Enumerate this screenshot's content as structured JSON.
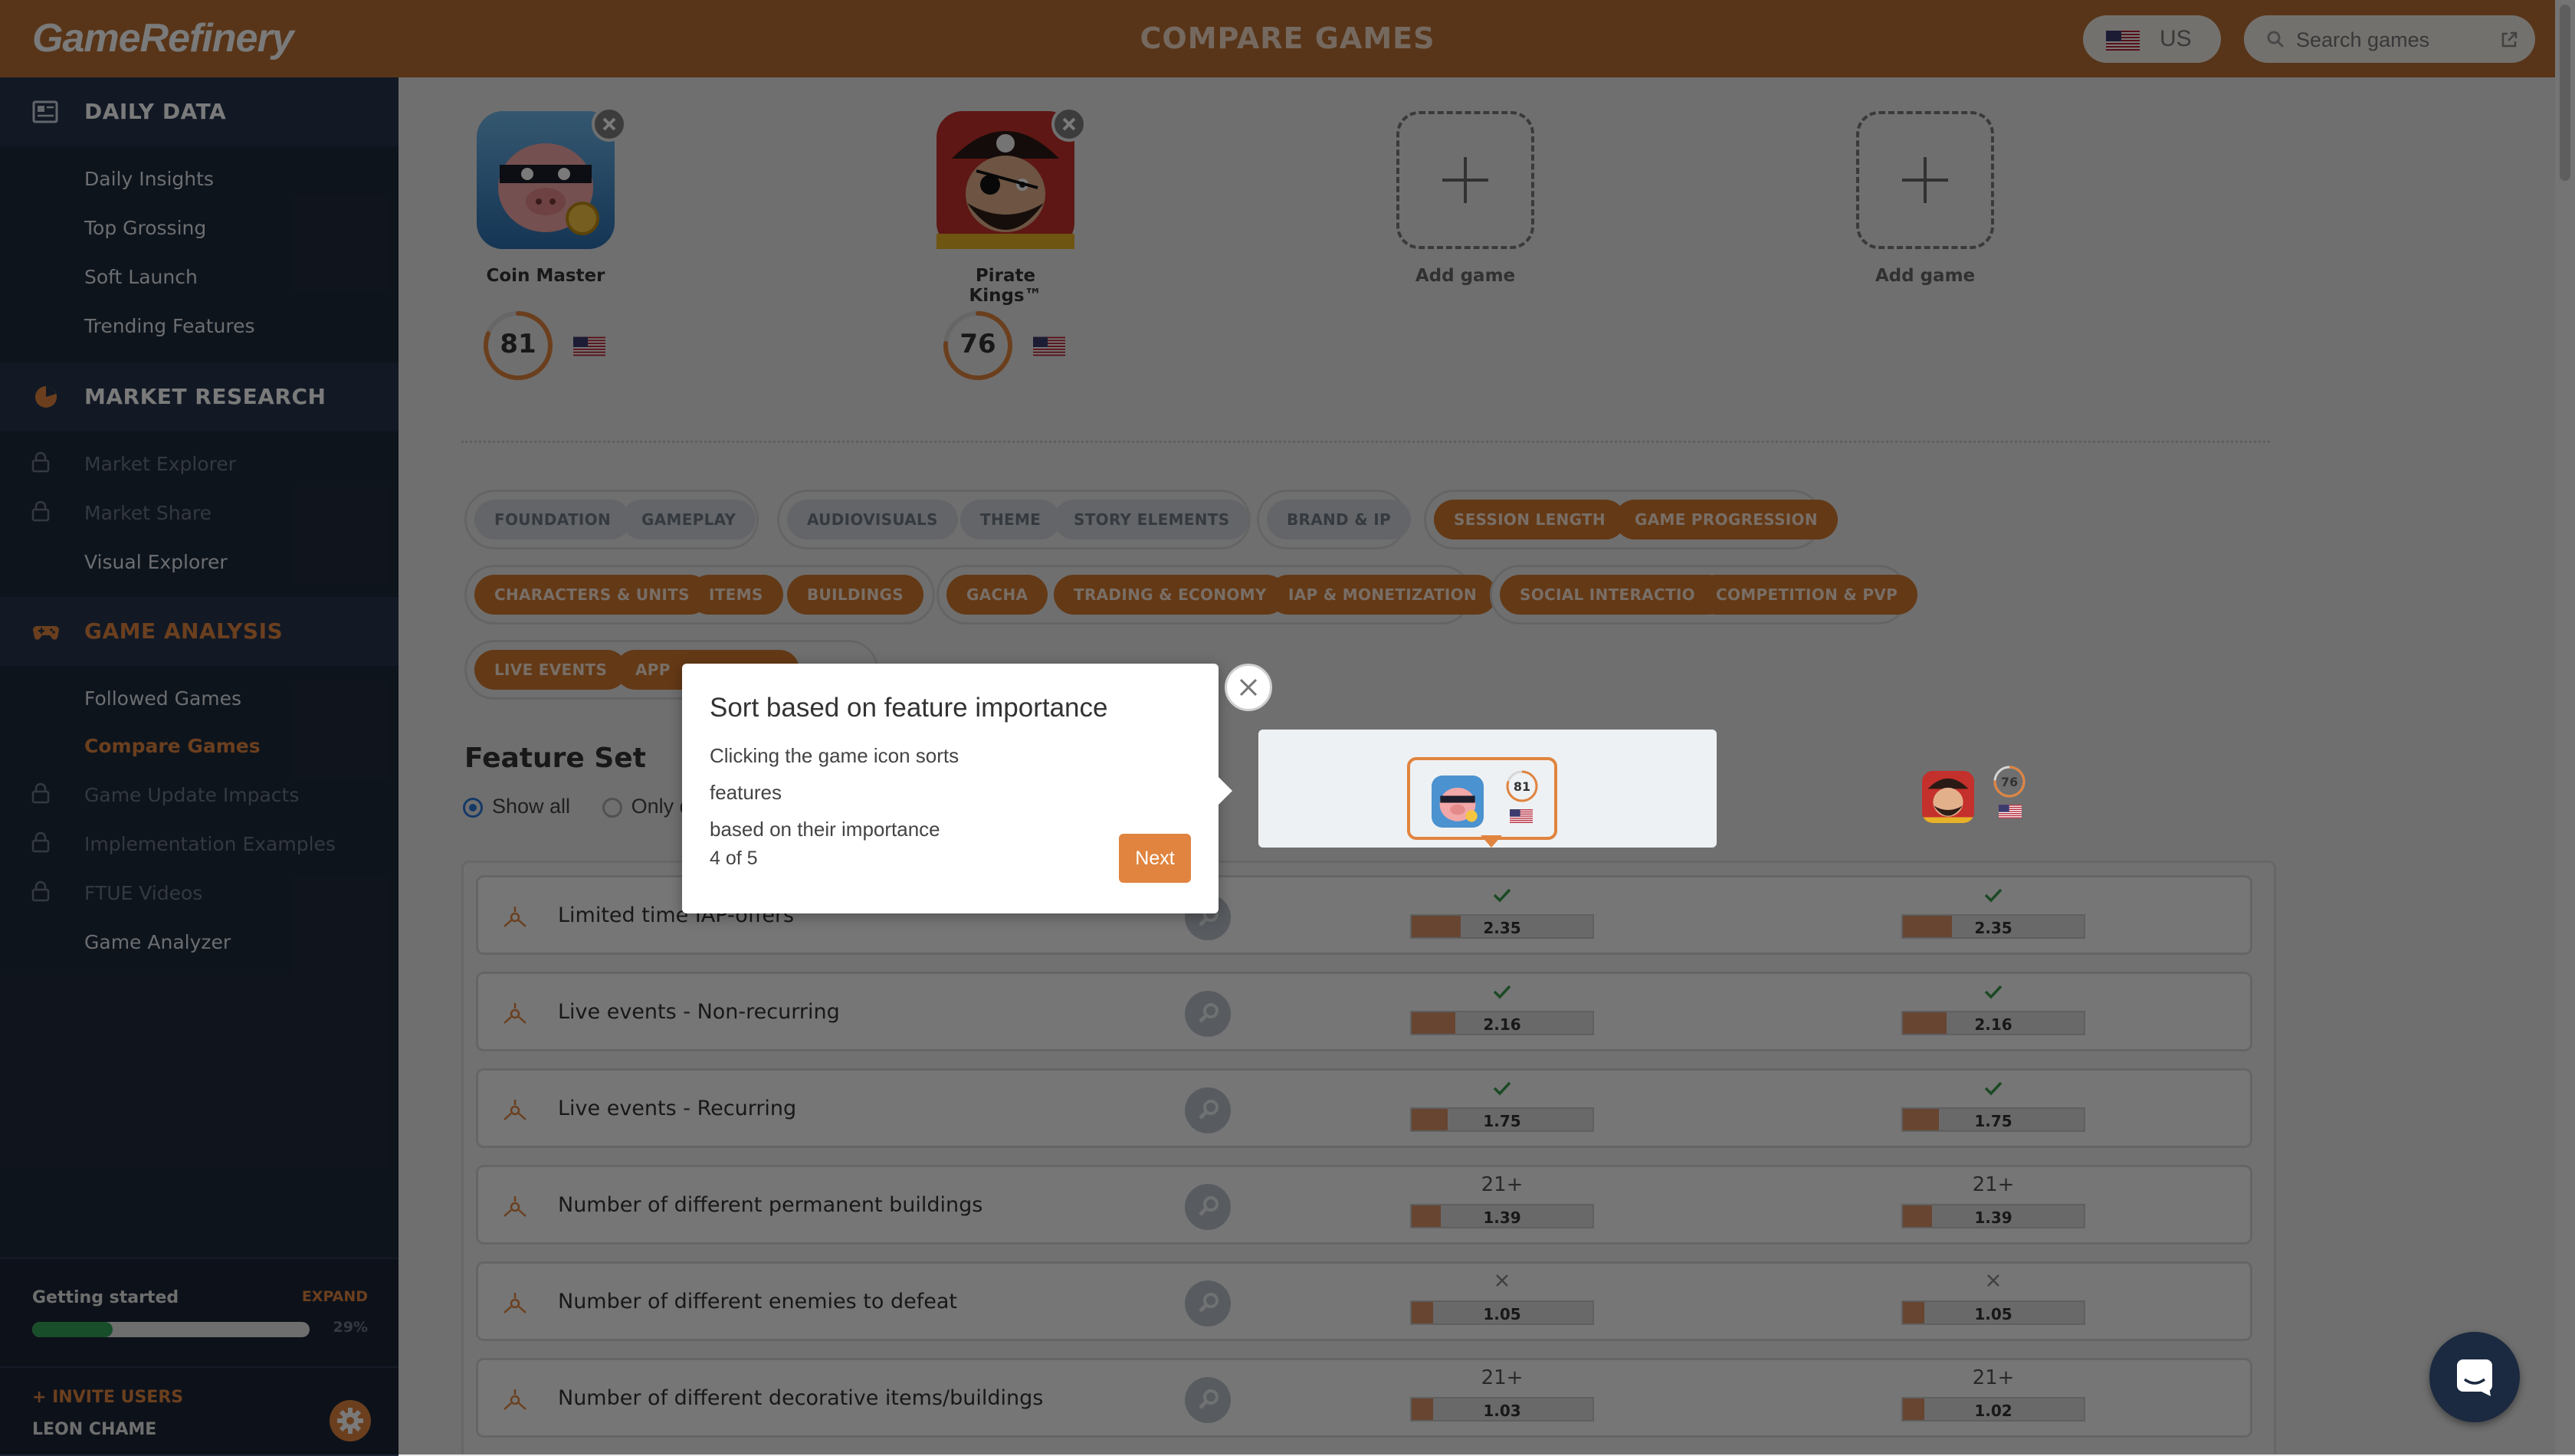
{
  "app": {
    "logo": "GameRefinery",
    "page_title": "COMPARE GAMES"
  },
  "header": {
    "country": "US",
    "search_placeholder": "Search games"
  },
  "sidebar": {
    "sections": [
      {
        "label": "DAILY DATA",
        "icon": "newspaper-icon",
        "items": [
          {
            "label": "Daily Insights",
            "locked": false
          },
          {
            "label": "Top Grossing",
            "locked": false
          },
          {
            "label": "Soft Launch",
            "locked": false
          },
          {
            "label": "Trending Features",
            "locked": false
          }
        ]
      },
      {
        "label": "MARKET RESEARCH",
        "icon": "pie-chart-icon",
        "items": [
          {
            "label": "Market Explorer",
            "locked": true
          },
          {
            "label": "Market Share",
            "locked": true
          },
          {
            "label": "Visual Explorer",
            "locked": false
          }
        ]
      },
      {
        "label": "GAME ANALYSIS",
        "icon": "gamepad-icon",
        "items": [
          {
            "label": "Followed Games",
            "locked": false
          },
          {
            "label": "Compare Games",
            "locked": false,
            "current": true
          },
          {
            "label": "Game Update Impacts",
            "locked": true
          },
          {
            "label": "Implementation Examples",
            "locked": true
          },
          {
            "label": "FTUE Videos",
            "locked": true
          },
          {
            "label": "Game Analyzer",
            "locked": false
          }
        ]
      }
    ],
    "getting_started": {
      "title": "Getting started",
      "expand": "EXPAND",
      "progress_pct": 29,
      "progress_text": "29%"
    },
    "invite": "+ INVITE USERS",
    "user_name": "LEON CHAME"
  },
  "games": [
    {
      "name": "Coin Master",
      "score": 81,
      "flag": "US"
    },
    {
      "name": "Pirate Kings™",
      "score": 76,
      "flag": "US"
    }
  ],
  "add_game_label": "Add game",
  "filter_groups": [
    [
      "FOUNDATION",
      "GAMEPLAY"
    ],
    [
      "AUDIOVISUALS",
      "THEME",
      "STORY ELEMENTS"
    ],
    [
      "BRAND & IP"
    ],
    [
      "SESSION LENGTH",
      "GAME PROGRESSION"
    ],
    [
      "CHARACTERS & UNITS",
      "ITEMS",
      "BUILDINGS"
    ],
    [
      "GACHA",
      "TRADING & ECONOMY",
      "IAP & MONETIZATION"
    ],
    [
      "SOCIAL INTERACTION",
      "COMPETITION & PVP"
    ],
    [
      "LIVE EVENTS",
      "APP"
    ]
  ],
  "feature_set": {
    "title": "Feature Set",
    "show_all": "Show all",
    "only_label": "Only d"
  },
  "features": [
    {
      "label": "Limited time IAP-offers",
      "icon": "shop-icon",
      "cells": [
        {
          "mark": "check",
          "value": "2.35",
          "fill": 0.27
        },
        {
          "mark": "check",
          "value": "2.35",
          "fill": 0.27
        }
      ]
    },
    {
      "label": "Live events - Non-recurring",
      "icon": "event-icon",
      "cells": [
        {
          "mark": "check",
          "value": "2.16",
          "fill": 0.24
        },
        {
          "mark": "check",
          "value": "2.16",
          "fill": 0.24
        }
      ]
    },
    {
      "label": "Live events - Recurring",
      "icon": "event-icon",
      "cells": [
        {
          "mark": "check",
          "value": "1.75",
          "fill": 0.2
        },
        {
          "mark": "check",
          "value": "1.75",
          "fill": 0.2
        }
      ]
    },
    {
      "label": "Number of different permanent buildings",
      "icon": "progression-icon",
      "cells": [
        {
          "mark": "21+",
          "value": "1.39",
          "fill": 0.16
        },
        {
          "mark": "21+",
          "value": "1.39",
          "fill": 0.16
        }
      ]
    },
    {
      "label": "Number of different enemies to defeat",
      "icon": "progression-icon",
      "cells": [
        {
          "mark": "cross",
          "value": "1.05",
          "fill": 0.12
        },
        {
          "mark": "cross",
          "value": "1.05",
          "fill": 0.12
        }
      ]
    },
    {
      "label": "Number of different decorative items/buildings",
      "icon": "progression-icon",
      "cells": [
        {
          "mark": "21+",
          "value": "1.03",
          "fill": 0.12
        },
        {
          "mark": "21+",
          "value": "1.02",
          "fill": 0.12
        }
      ]
    }
  ],
  "tooltip": {
    "title": "Sort based on feature importance",
    "line1": "Clicking the game icon sorts features",
    "line2": "based on their importance",
    "step": "4 of 5",
    "next": "Next"
  },
  "colors": {
    "brand": "#b86f35",
    "accent": "#e0843f",
    "sidebar": "#1f2a3c",
    "check": "#3a9a4d"
  }
}
